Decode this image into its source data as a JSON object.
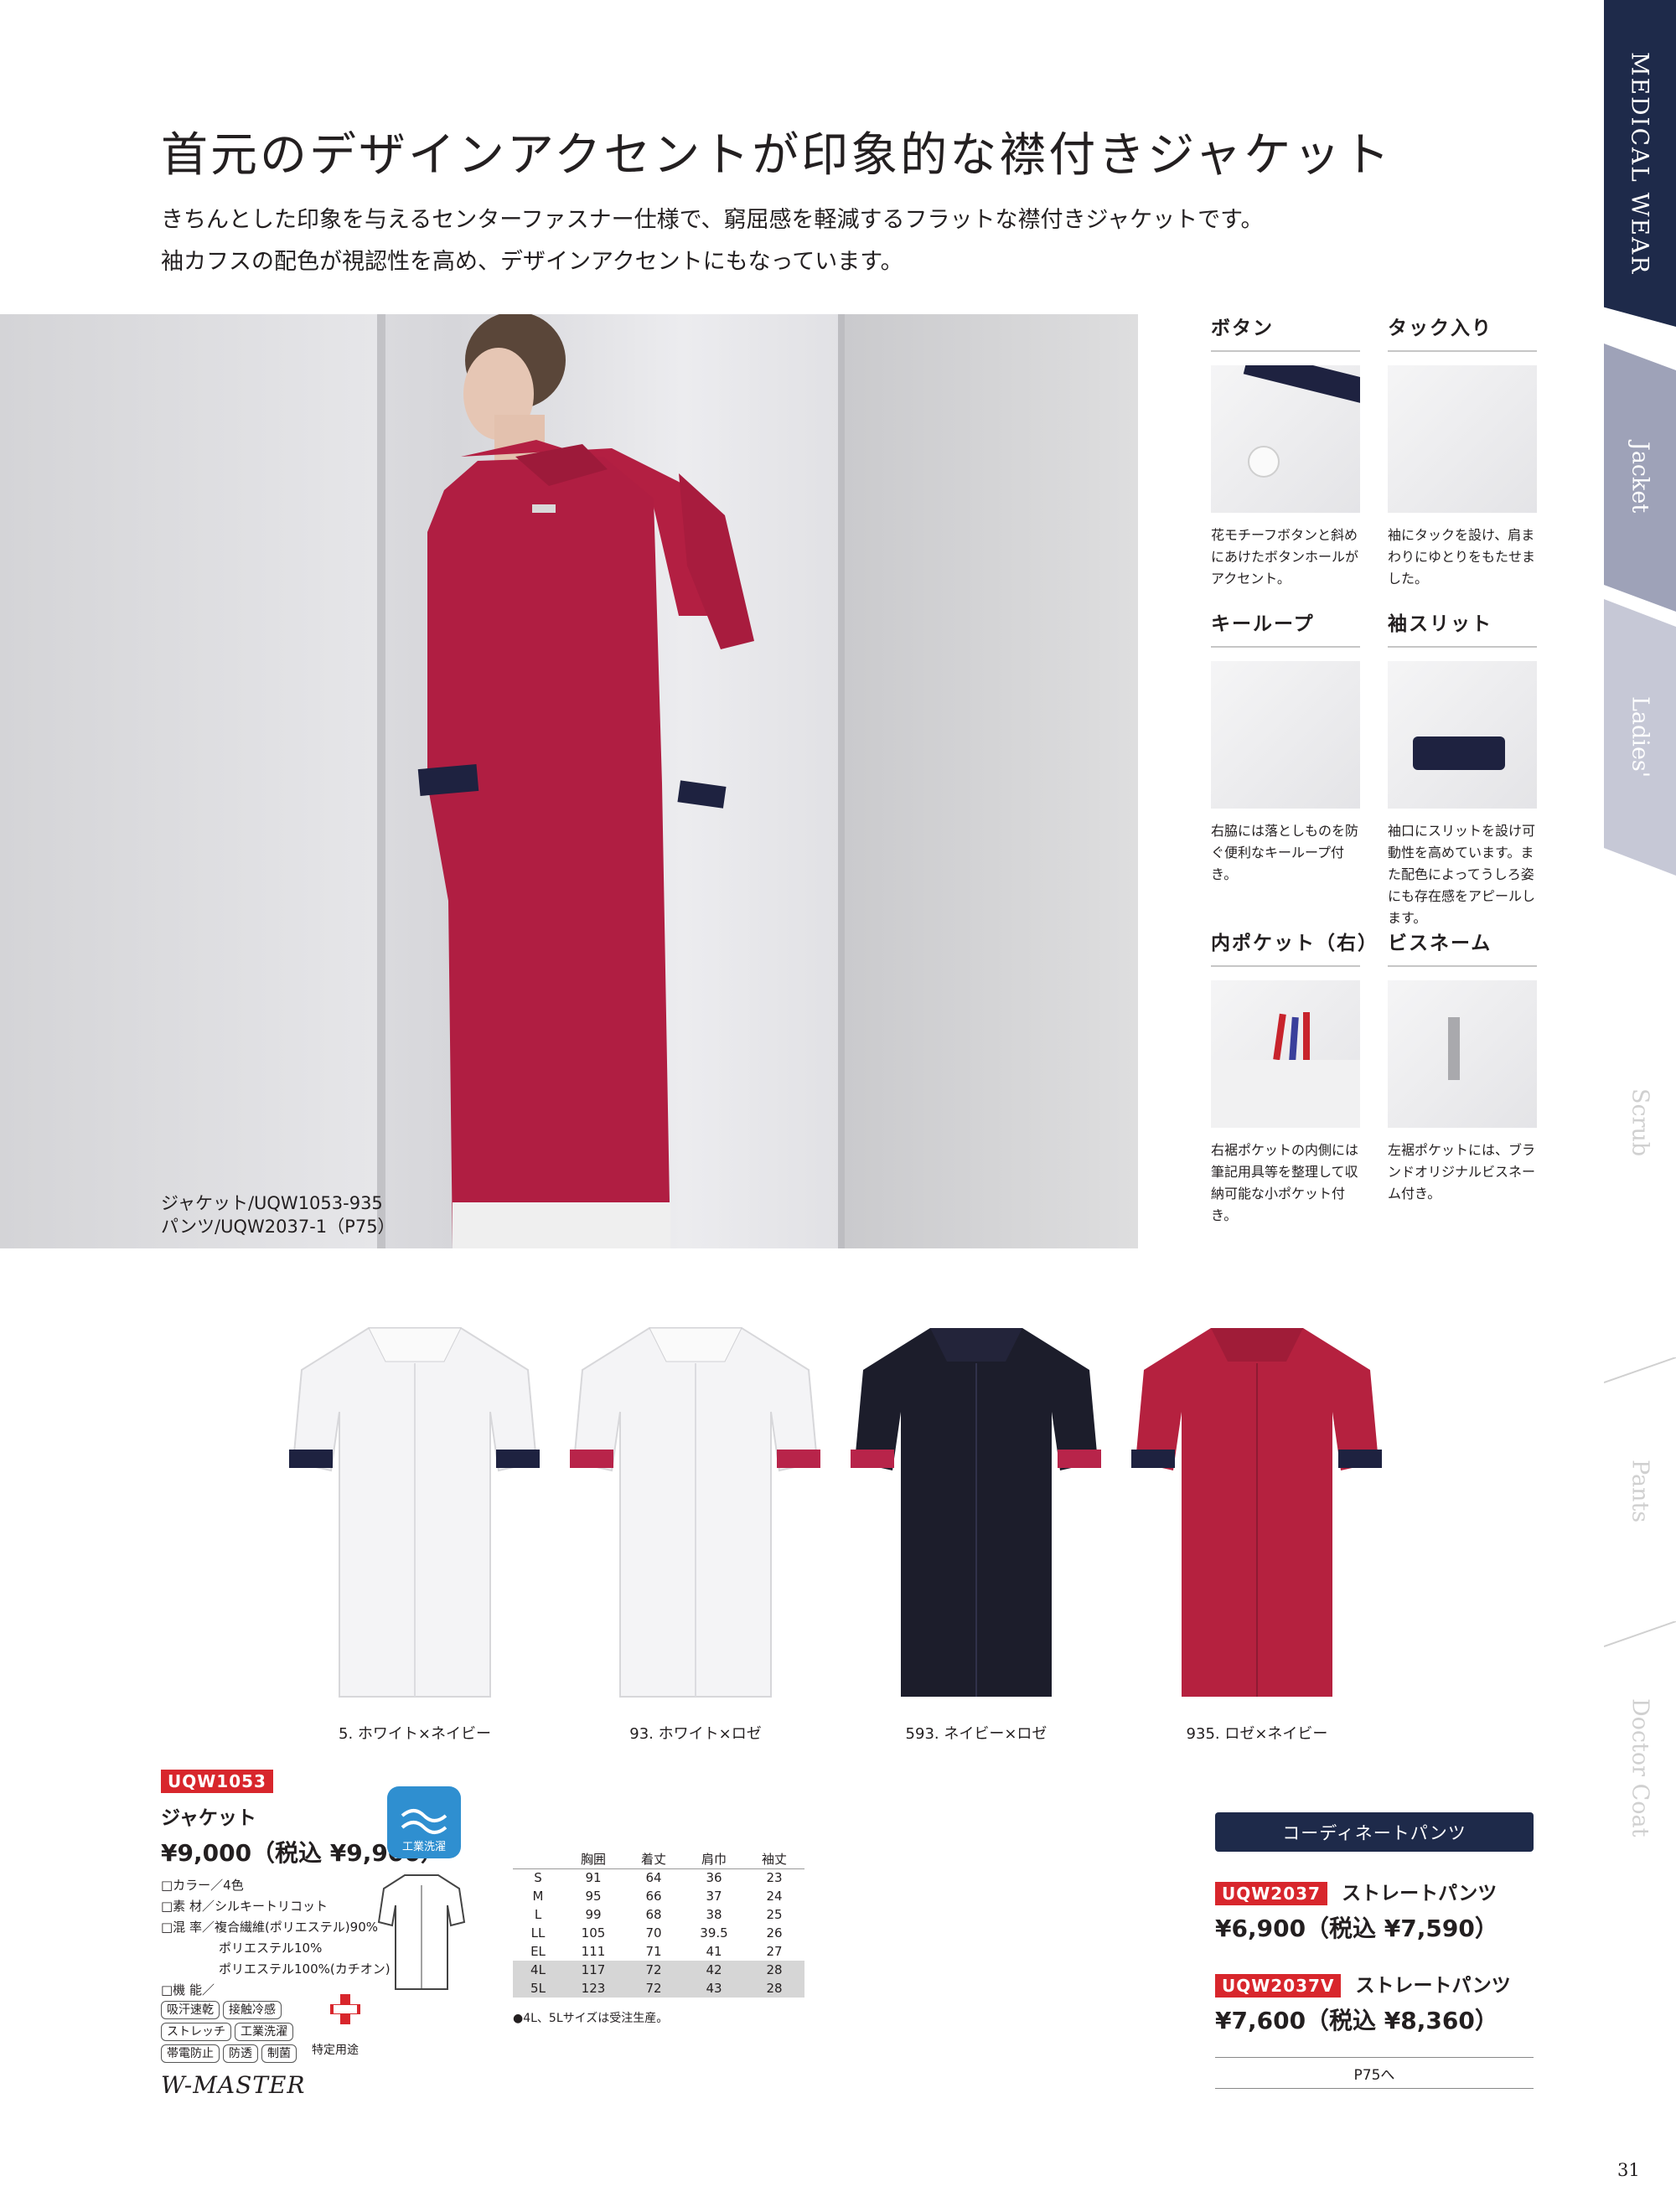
{
  "headline": "首元のデザインアクセントが印象的な襟付きジャケット",
  "lead": [
    "きちんとした印象を与えるセンターファスナー仕様で、窮屈感を軽減するフラットな襟付きジャケットです。",
    "袖カフスの配色が視認性を高め、デザインアクセントにもなっています。"
  ],
  "hero_caption": [
    "ジャケット/UQW1053-935",
    "パンツ/UQW2037-1（P75）"
  ],
  "details": [
    {
      "title": "ボタン",
      "text": "花モチーフボタンと斜めにあけたボタンホールがアクセント。"
    },
    {
      "title": "タック入り",
      "text": "袖にタックを設け、肩まわりにゆとりをもたせました。"
    },
    {
      "title": "キーループ",
      "text": "右脇には落としものを防ぐ便利なキーループ付き。"
    },
    {
      "title": "袖スリット",
      "text": "袖口にスリットを設け可動性を高めています。また配色によってうしろ姿にも存在感をアピールします。"
    },
    {
      "title": "内ポケット（右）",
      "text": "右裾ポケットの内側には筆記用具等を整理して収納可能な小ポケット付き。"
    },
    {
      "title": "ビスネーム",
      "text": "左裾ポケットには、ブランドオリジナルビスネーム付き。"
    }
  ],
  "side_tabs": [
    "MEDICAL WEAR",
    "Jacket",
    "Ladies'",
    "Scrub",
    "Pants",
    "Doctor Coat"
  ],
  "colors": [
    {
      "label": "5. ホワイト×ネイビー",
      "body": "#f4f4f6",
      "cuff": "#1e2240",
      "accent": "#1e2240"
    },
    {
      "label": "93. ホワイト×ロゼ",
      "body": "#f4f4f6",
      "cuff": "#b8244a",
      "accent": "#b8244a"
    },
    {
      "label": "593. ネイビー×ロゼ",
      "body": "#1c1d2b",
      "cuff": "#b8244a",
      "accent": "#b8244a"
    },
    {
      "label": "935. ロゼ×ネイビー",
      "body": "#b5213f",
      "cuff": "#1e2240",
      "accent": "#1e2240"
    }
  ],
  "product": {
    "code": "UQW1053",
    "name": "ジャケット",
    "price": "¥9,000（税込 ¥9,900）",
    "wash_label": "工業洗濯",
    "specs": [
      "□カラー／4色",
      "□素 材／シルキートリコット",
      "□混 率／複合繊維(ポリエステル)90%",
      "ポリエステル10%",
      "ポリエステル100%(カチオン)",
      "□機 能／"
    ],
    "functions": [
      [
        "吸汗速乾",
        "接触冷感"
      ],
      [
        "ストレッチ",
        "工業洗濯"
      ],
      [
        "帯電防止",
        "防透",
        "制菌"
      ]
    ],
    "sek_label": "特定用途",
    "brand": "W-MASTER"
  },
  "size_table": {
    "headers": [
      "",
      "胸囲",
      "着丈",
      "肩巾",
      "袖丈"
    ],
    "rows": [
      [
        "S",
        "91",
        "64",
        "36",
        "23"
      ],
      [
        "M",
        "95",
        "66",
        "37",
        "24"
      ],
      [
        "L",
        "99",
        "68",
        "38",
        "25"
      ],
      [
        "LL",
        "105",
        "70",
        "39.5",
        "26"
      ],
      [
        "EL",
        "111",
        "71",
        "41",
        "27"
      ],
      [
        "4L",
        "117",
        "72",
        "42",
        "28"
      ],
      [
        "5L",
        "123",
        "72",
        "43",
        "28"
      ]
    ],
    "note": "●4L、5Lサイズは受注生産。"
  },
  "coordinate": {
    "heading": "コーディネートパンツ",
    "items": [
      {
        "code": "UQW2037",
        "name": "ストレートパンツ",
        "price": "¥6,900（税込 ¥7,590）"
      },
      {
        "code": "UQW2037V",
        "name": "ストレートパンツ",
        "price": "¥7,600（税込 ¥8,360）"
      }
    ],
    "ref": "P75へ"
  },
  "page_number": "31"
}
